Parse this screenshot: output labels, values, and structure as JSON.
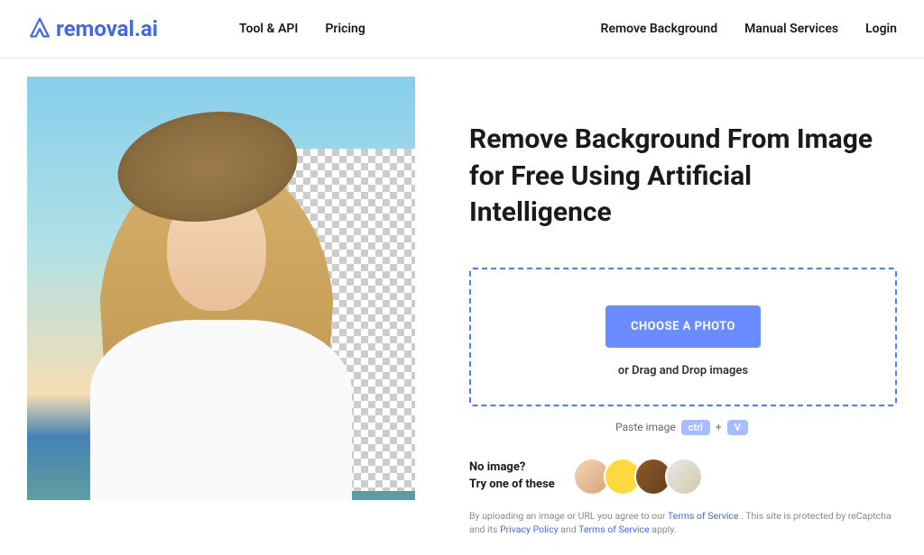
{
  "brand": {
    "name": "removal.ai",
    "accent": "#4169E1"
  },
  "nav": {
    "left": [
      {
        "label": "Tool & API"
      },
      {
        "label": "Pricing"
      }
    ],
    "right": [
      {
        "label": "Remove Background"
      },
      {
        "label": "Manual Services"
      },
      {
        "label": "Login"
      }
    ]
  },
  "hero": {
    "headline": "Remove Background From Image for Free Using Artificial Intelligence"
  },
  "dropzone": {
    "button_label": "CHOOSE A PHOTO",
    "drag_text": "or Drag and Drop images"
  },
  "paste_hint": {
    "prefix": "Paste image",
    "key1": "ctrl",
    "plus": "+",
    "key2": "V"
  },
  "samples": {
    "line1": "No image?",
    "line2": "Try one of these",
    "thumbs": [
      "person",
      "car",
      "bag",
      "dog"
    ]
  },
  "legal": {
    "pre": "By uploading an image or URL you agree to our ",
    "tos": "Terms of Service",
    "mid": " . This site is protected by reCaptcha and its ",
    "privacy": "Privacy Policy",
    "and": " and ",
    "tos2": "Terms of Service",
    "suffix": " apply."
  }
}
